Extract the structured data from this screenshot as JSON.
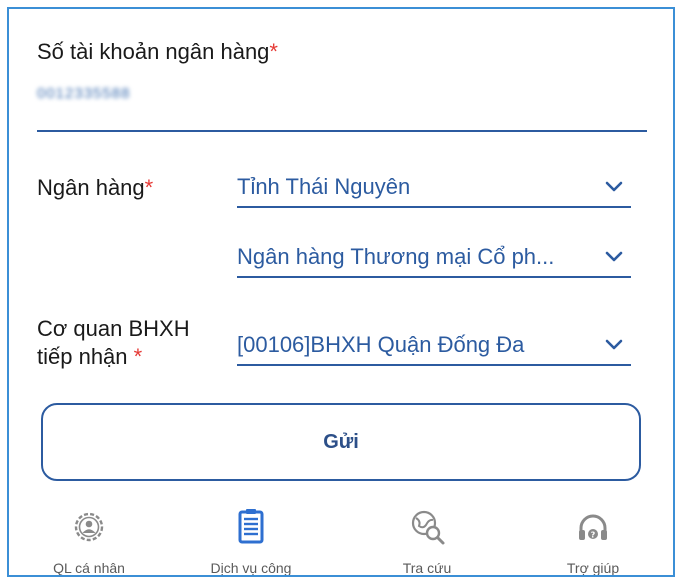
{
  "form": {
    "account_label": "Số tài khoản ngân hàng",
    "required_mark": "*",
    "account_value": "0012335588",
    "bank_label": "Ngân hàng",
    "province_value": "Tỉnh Thái Nguyên",
    "bank_value": "Ngân hàng Thương mại Cổ ph...",
    "office_label_line1": "Cơ quan BHXH",
    "office_label_line2": "tiếp nhận",
    "office_value": "[00106]BHXH Quận Đống Đa",
    "submit_label": "Gửi"
  },
  "nav": {
    "items": [
      {
        "label": "QL cá nhân",
        "icon": "user-gear-icon"
      },
      {
        "label": "Dịch vụ công",
        "icon": "document-list-icon"
      },
      {
        "label": "Tra cứu",
        "icon": "globe-search-icon"
      },
      {
        "label": "Trợ giúp",
        "icon": "headset-icon"
      }
    ]
  },
  "colors": {
    "accent": "#2c5ba0",
    "required": "#e53935",
    "frame": "#3b8fd6",
    "active_icon": "#2e6fd0",
    "inactive_icon": "#8a8a8a"
  }
}
